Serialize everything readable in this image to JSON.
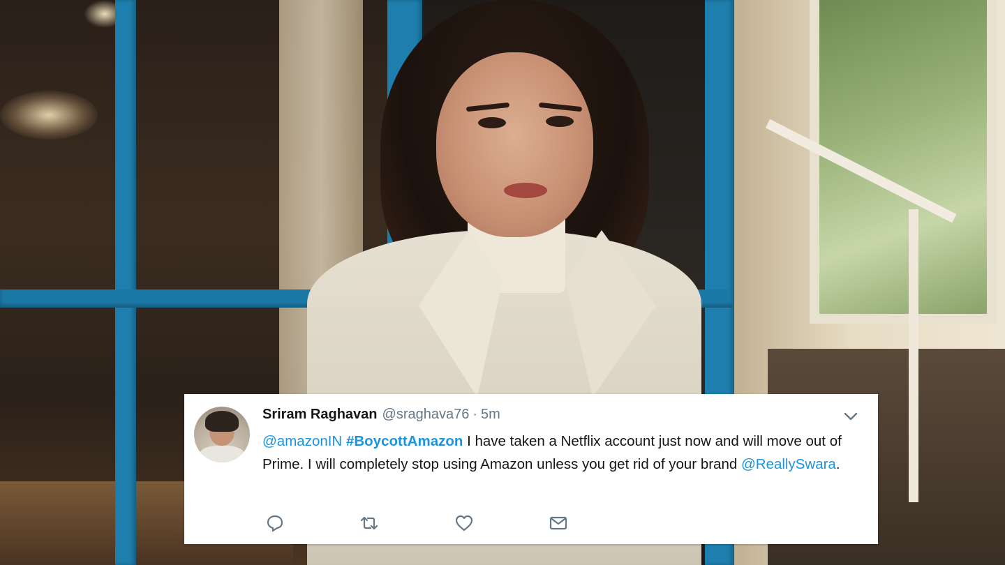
{
  "tweet": {
    "author_name": "Sriram Raghavan",
    "author_handle": "@sraghava76",
    "separator": "·",
    "time": "5m",
    "text_parts": [
      {
        "text": "@amazonIN",
        "kind": "mention"
      },
      {
        "text": " ",
        "kind": "text"
      },
      {
        "text": "#BoycottAmazon",
        "kind": "hashtag"
      },
      {
        "text": " I have taken a Netflix account just now and will move out of Prime. I will completely stop using Amazon unless you get rid of your brand ",
        "kind": "text"
      },
      {
        "text": "@ReallySwara",
        "kind": "mention"
      },
      {
        "text": ".",
        "kind": "text"
      }
    ],
    "actions": [
      {
        "name": "reply-icon"
      },
      {
        "name": "retweet-icon"
      },
      {
        "name": "like-icon"
      },
      {
        "name": "direct-message-icon"
      }
    ],
    "menu_icon": "chevron-down-icon"
  },
  "colors": {
    "link": "#1b95e0",
    "icon": "#657786",
    "text": "#14171a",
    "frame": "#1e7fae"
  }
}
